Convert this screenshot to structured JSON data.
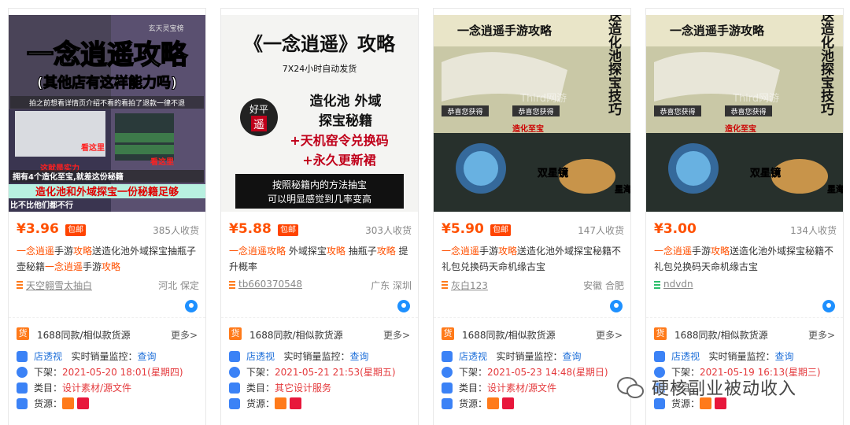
{
  "colors": {
    "price": "#ff5000",
    "link": "#1e6fd9",
    "date": "#e4393c",
    "mail_badge": "#ff4400"
  },
  "products": [
    {
      "price": "¥3.96",
      "mail_badge": "包邮",
      "sold": "385人收货",
      "title_parts": [
        {
          "t": "一念逍遥",
          "hl": true
        },
        {
          "t": "手游",
          "hl": false
        },
        {
          "t": "攻略",
          "hl": true
        },
        {
          "t": "送造化池外域探宝抽瓶子壶秘籍",
          "hl": false
        },
        {
          "t": "一念逍遥",
          "hl": true
        },
        {
          "t": "手游",
          "hl": false
        },
        {
          "t": "攻略",
          "hl": true
        }
      ],
      "shop": "天空翱雪太抽白",
      "shop_icon_color": "#ff7a1a",
      "location": "河北 保定",
      "same_text": "1688同款/相似款货源",
      "more": "更多>",
      "shop_view_label": "店透视",
      "monitor_label": "实时销量监控：",
      "monitor_link": "查询",
      "offshelf_label": "下架：",
      "offshelf_value": "2021-05-20 18:01(星期四)",
      "category_label": "类目：",
      "category_value": "设计素材/源文件",
      "source_label": "货源：",
      "image": {
        "line1": "一念逍遥攻略",
        "line2": "(其他店有这样能力吗)",
        "line3": "拍之前想看详情页介绍不看的看拍了退款一律不退",
        "note1": "这就是实力",
        "note2": "看这里",
        "note3": "看这里",
        "line4": "拥有4个造化至宝,就差这份秘籍",
        "line5": "造化池和外域探宝一份秘籍足够",
        "line6": "比不比他们都不行",
        "top_small": "玄天灵宝榜"
      }
    },
    {
      "price": "¥5.88",
      "mail_badge": "包邮",
      "sold": "303人收货",
      "title_parts": [
        {
          "t": "一念逍遥",
          "hl": true
        },
        {
          "t": "攻略",
          "hl": true
        },
        {
          "t": " 外域探宝",
          "hl": false
        },
        {
          "t": "攻略",
          "hl": true
        },
        {
          "t": " 抽瓶子",
          "hl": false
        },
        {
          "t": "攻略",
          "hl": true
        },
        {
          "t": " 提升概率",
          "hl": false
        }
      ],
      "shop": "tb660370548",
      "shop_icon_color": "#ff7a1a",
      "location": "广东 深圳",
      "same_text": "1688同款/相似款货源",
      "more": "更多>",
      "shop_view_label": "店透视",
      "monitor_label": "实时销量监控：",
      "monitor_link": "查询",
      "offshelf_label": "下架：",
      "offshelf_value": "2021-05-21 21:53(星期五)",
      "category_label": "类目：",
      "category_value": "其它设计服务",
      "source_label": "货源：",
      "image": {
        "line1": "《一念逍遥》攻略",
        "line2": "7X24小时自动发货",
        "line3": "造化池 外域",
        "line4": "探宝秘籍",
        "line5": "+天机窑令兑换码",
        "line6": "+永久更新裙",
        "line7": "按照秘籍内的方法抽宝",
        "line8": "可以明显感觉到几率变高",
        "seal_top": "好平",
        "seal_bottom": "遥"
      }
    },
    {
      "price": "¥5.90",
      "mail_badge": "包邮",
      "sold": "147人收货",
      "title_parts": [
        {
          "t": "一念逍遥",
          "hl": true
        },
        {
          "t": "手游",
          "hl": false
        },
        {
          "t": "攻略",
          "hl": true
        },
        {
          "t": "送造化池外域探宝秘籍不礼包兑换码天命机缘古宝",
          "hl": false
        }
      ],
      "shop": "灰白123",
      "shop_icon_color": "#ff7a1a",
      "location": "安徽 合肥",
      "same_text": "1688同款/相似款货源",
      "more": "更多>",
      "shop_view_label": "店透视",
      "monitor_label": "实时销量监控：",
      "monitor_link": "查询",
      "offshelf_label": "下架：",
      "offshelf_value": "2021-05-23 14:48(星期日)",
      "category_label": "类目：",
      "category_value": "设计素材/源文件",
      "source_label": "货源：",
      "image": {
        "line1": "一念逍遥手游攻略",
        "side": "送造化池探宝技巧",
        "tag1": "恭喜您获得",
        "tag2": "恭喜您获得",
        "item1": "双星镜",
        "item2": "星海瓶",
        "tag3": "造化至宝",
        "wm": "Third网游"
      }
    },
    {
      "price": "¥3.00",
      "mail_badge": "",
      "sold": "134人收货",
      "title_parts": [
        {
          "t": "一念逍遥",
          "hl": true
        },
        {
          "t": "手游",
          "hl": false
        },
        {
          "t": "攻略",
          "hl": true
        },
        {
          "t": "送造化池外域探宝秘籍不礼包兑换码天命机缘古宝",
          "hl": false
        }
      ],
      "shop": "ndvdn",
      "shop_icon_color": "#2bbf6a",
      "location": "",
      "same_text": "1688同款/相似款货源",
      "more": "更多>",
      "shop_view_label": "店透视",
      "monitor_label": "实时销量监控：",
      "monitor_link": "查询",
      "offshelf_label": "下架：",
      "offshelf_value": "2021-05-19 16:13(星期三)",
      "category_label": "类目：",
      "category_value": "",
      "source_label": "货源：",
      "image": {
        "line1": "一念逍遥手游攻略",
        "side": "送造化池探宝技巧",
        "tag1": "恭喜您获得",
        "tag2": "恭喜您获得",
        "item1": "双星镜",
        "item2": "星海瓶",
        "tag3": "造化至宝",
        "wm": "Third网游"
      }
    }
  ],
  "watermark": {
    "text": "硬核副业被动收入"
  }
}
